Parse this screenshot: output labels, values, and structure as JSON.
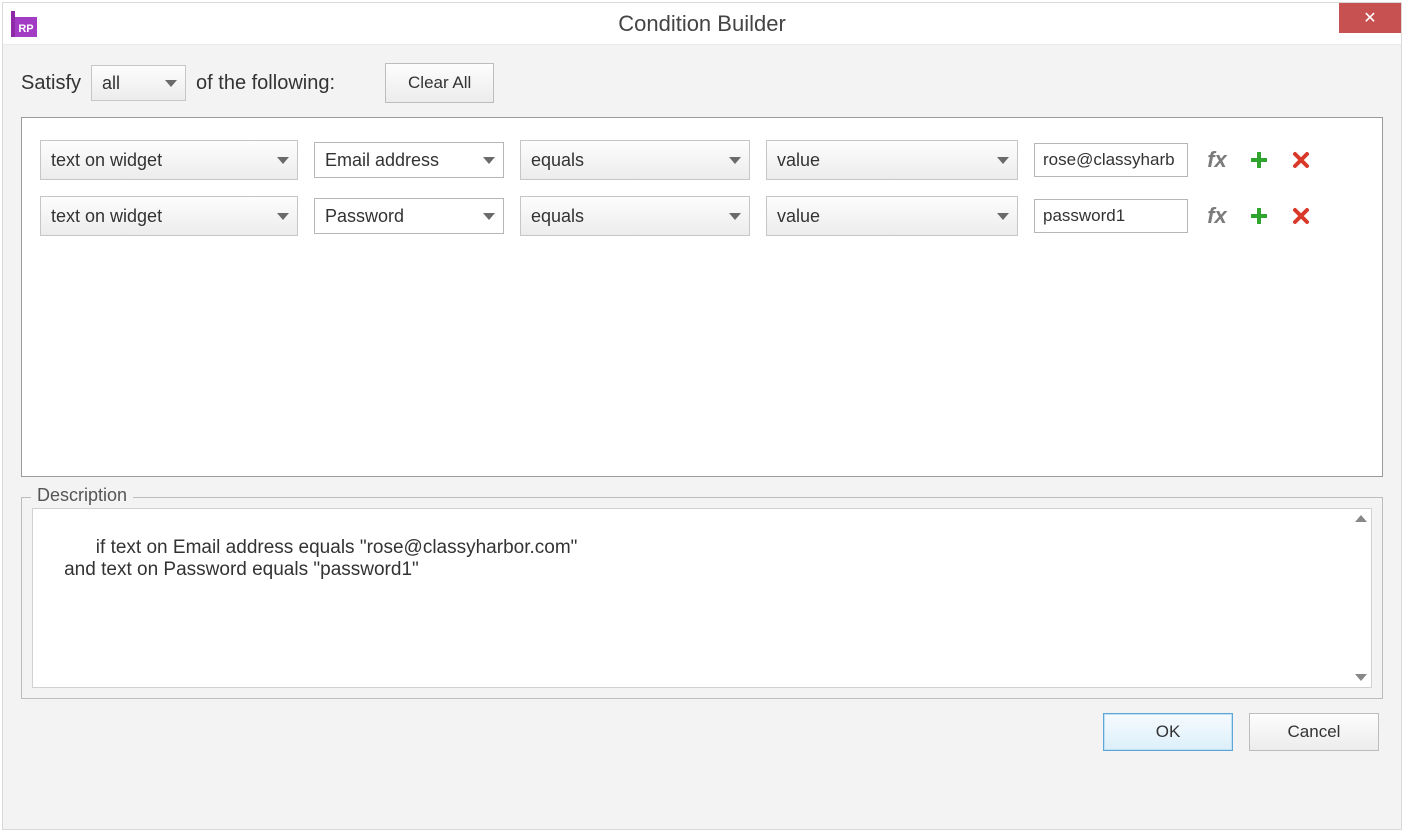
{
  "titlebar": {
    "title": "Condition Builder",
    "app_icon_label": "RP",
    "close_glyph": "✕"
  },
  "satisfy": {
    "prefix": "Satisfy",
    "mode": "all",
    "suffix": "of the following:",
    "clear_all": "Clear All"
  },
  "conditions": [
    {
      "source": "text on widget",
      "widget": "Email address",
      "operator": "equals",
      "rhs_type": "value",
      "rhs_value": "rose@classyharb",
      "fx_label": "fx"
    },
    {
      "source": "text on widget",
      "widget": "Password",
      "operator": "equals",
      "rhs_type": "value",
      "rhs_value": "password1",
      "fx_label": "fx"
    }
  ],
  "description": {
    "legend": "Description",
    "text": "if text on Email address equals \"rose@classyharbor.com\"\n    and text on Password equals \"password1\""
  },
  "footer": {
    "ok": "OK",
    "cancel": "Cancel"
  }
}
